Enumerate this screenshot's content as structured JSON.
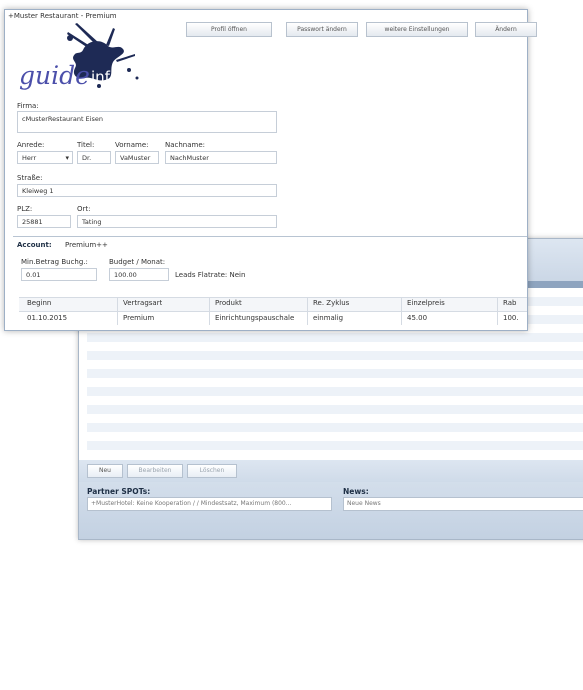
{
  "front": {
    "window_title": "+Muster Restaurant - Premium",
    "toolbar": [
      "Profil öffnen",
      "Passwort ändern",
      "weitere Einstellungen",
      "Ändern"
    ],
    "logo": {
      "text": "guide",
      "suffix": "info",
      "text_color": "#4b4faa",
      "splash_color": "#1e2a55"
    },
    "firma": {
      "label": "Firma:",
      "value": "cMusterRestaurant Eisen"
    },
    "anrede": {
      "label": "Anrede:",
      "value": "Herr"
    },
    "titel": {
      "label": "Titel:",
      "value": "Dr."
    },
    "vorname": {
      "label": "Vorname:",
      "value": "VaMuster"
    },
    "nachname": {
      "label": "Nachname:",
      "value": "NachMuster"
    },
    "strasse": {
      "label": "Straße:",
      "value": "Kleiweg 1"
    },
    "plz": {
      "label": "PLZ:",
      "value": "25881"
    },
    "ort": {
      "label": "Ort:",
      "value": "Tating"
    },
    "account": {
      "label": "Account:",
      "value": "Premium++"
    },
    "min_betrag": {
      "label": "Min.Betrag Buchg.:",
      "value": "0.01"
    },
    "budget": {
      "label": "Budget / Monat:",
      "value": "100.00"
    },
    "leads": "Leads Flatrate: Nein",
    "grid": {
      "columns": [
        "Beginn",
        "Vertragsart",
        "Produkt",
        "Re. Zyklus",
        "Einzelpreis",
        "Rab"
      ],
      "rows": [
        [
          "01.10.2015",
          "Premium",
          "Einrichtungspauschale",
          "einmalig",
          "45.00",
          "100."
        ]
      ]
    }
  },
  "back": {
    "buttons": [
      "Neu",
      "Bearbeiten",
      "Löschen"
    ],
    "partner_spots": {
      "title": "Partner SPOTs:",
      "item": "+MusterHotel: Keine Kooperation / / Mindestsatz, Maximum (800..."
    },
    "news": {
      "title": "News:",
      "item": "Neue News"
    }
  },
  "colors": {
    "accent": "#8ea4bf",
    "window_border": "#9eb0c6",
    "stripe": "#edf2f8"
  }
}
